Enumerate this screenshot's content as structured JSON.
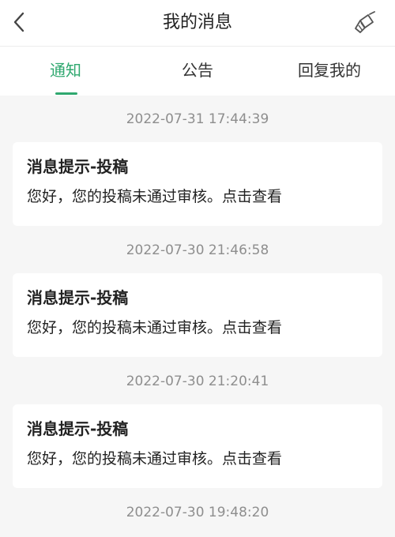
{
  "header": {
    "title": "我的消息"
  },
  "tabs": [
    {
      "label": "通知",
      "active": true
    },
    {
      "label": "公告",
      "active": false
    },
    {
      "label": "回复我的",
      "active": false
    }
  ],
  "accent_color": "#2fa86f",
  "icons": {
    "back": "chevron-left-icon",
    "clear": "broom-icon"
  },
  "messages": [
    {
      "timestamp": "2022-07-31 17:44:39",
      "title": "消息提示-投稿",
      "body": "您好，您的投稿未通过审核。点击查看"
    },
    {
      "timestamp": "2022-07-30 21:46:58",
      "title": "消息提示-投稿",
      "body": "您好，您的投稿未通过审核。点击查看"
    },
    {
      "timestamp": "2022-07-30 21:20:41",
      "title": "消息提示-投稿",
      "body": "您好，您的投稿未通过审核。点击查看"
    },
    {
      "timestamp": "2022-07-30 19:48:20"
    }
  ]
}
